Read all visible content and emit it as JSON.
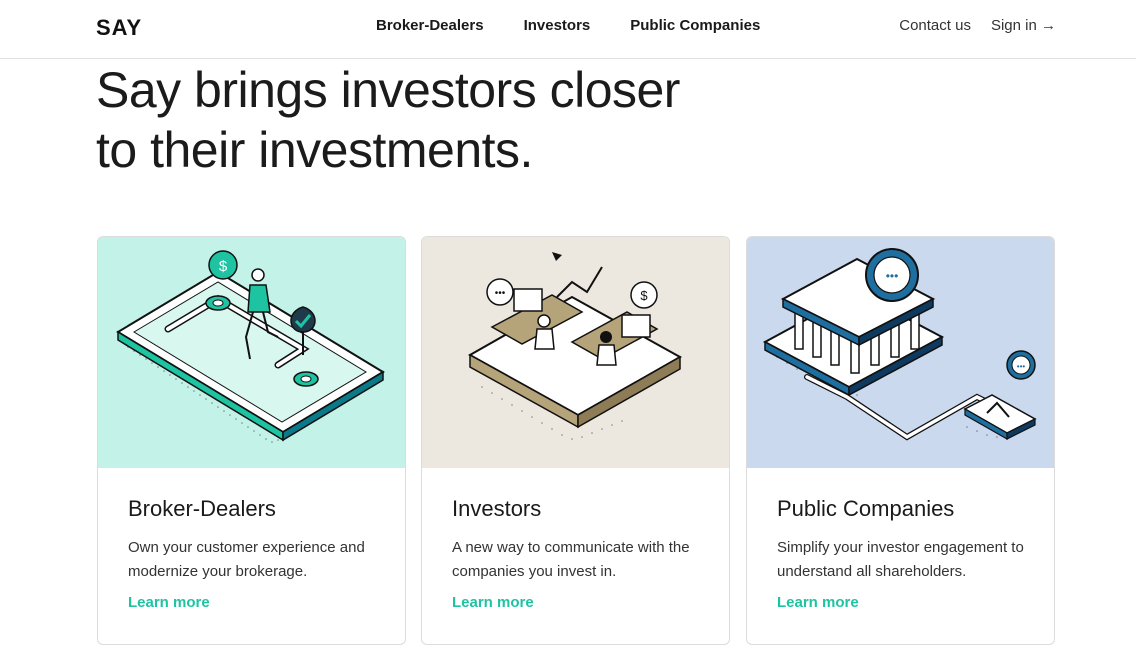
{
  "header": {
    "logo": "SAY",
    "nav": [
      "Broker-Dealers",
      "Investors",
      "Public Companies"
    ],
    "contact": "Contact us",
    "signin": "Sign in →"
  },
  "hero": {
    "line1": "Say brings investors closer",
    "line2": "to their investments."
  },
  "cards": [
    {
      "title": "Broker-Dealers",
      "desc": "Own your customer experience and modernize your brokerage.",
      "link": "Learn more",
      "bg": "#c3f2e8"
    },
    {
      "title": "Investors",
      "desc": "A new way to communicate with the companies you invest in.",
      "link": "Learn more",
      "bg": "#ede8df"
    },
    {
      "title": "Public Companies",
      "desc": "Simplify your investor engagement to understand all shareholders.",
      "link": "Learn more",
      "bg": "#cad9ee"
    }
  ],
  "colors": {
    "accent": "#1ec4a2",
    "text": "#1a1a1a"
  }
}
